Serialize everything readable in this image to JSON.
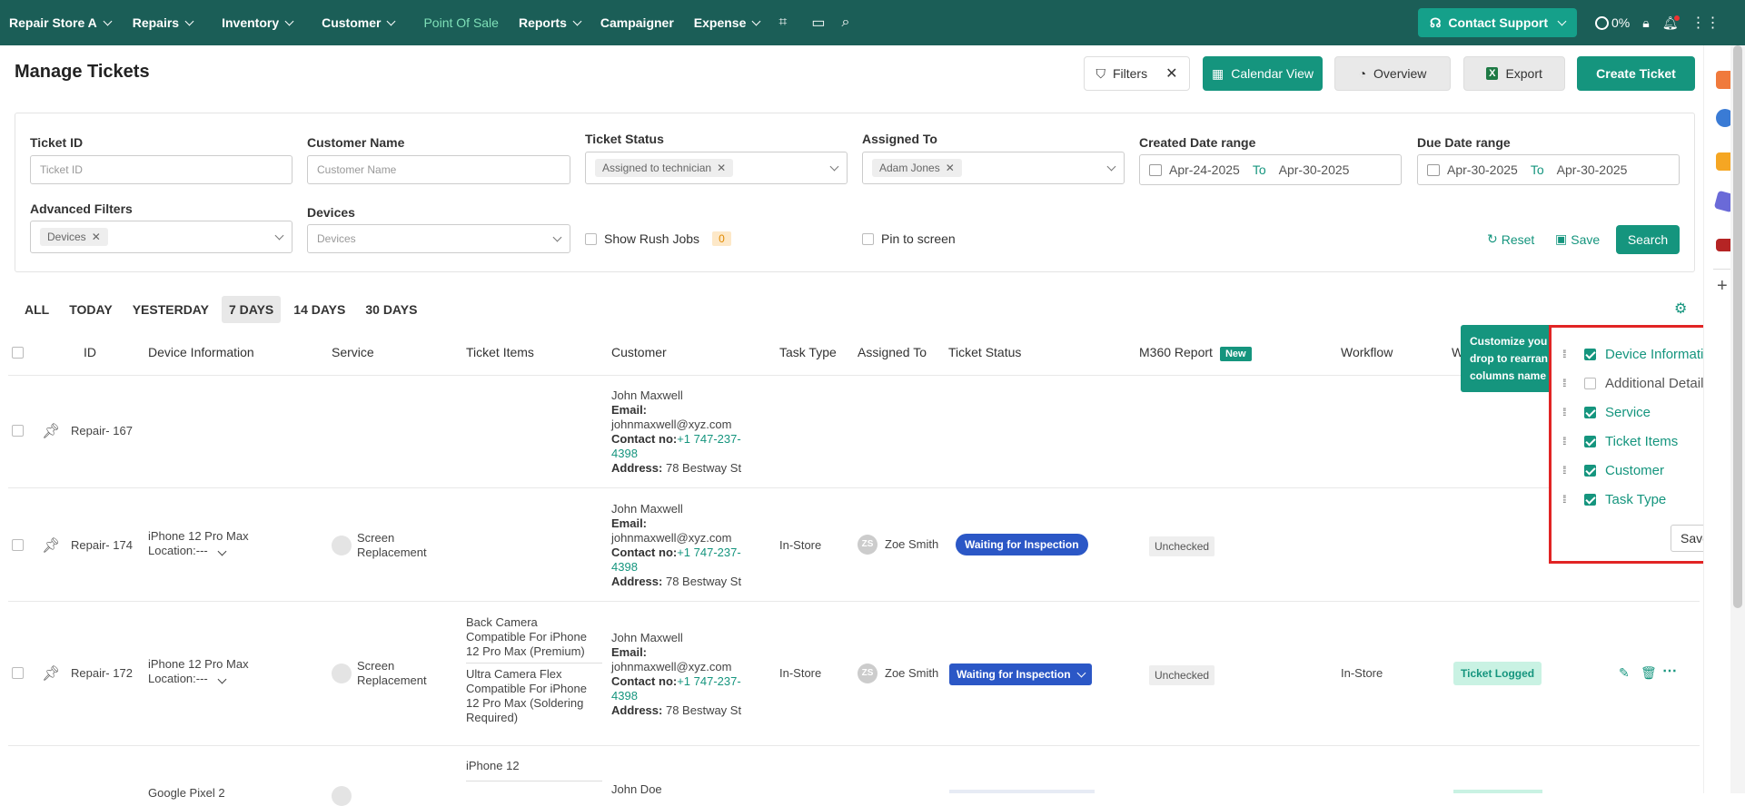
{
  "nav": {
    "store": "Repair Store A",
    "items": [
      "Repairs",
      "Inventory",
      "Customer",
      "Point Of Sale",
      "Reports",
      "Campaigner",
      "Expense"
    ],
    "support": "Contact Support",
    "usage": "0%"
  },
  "header": {
    "title": "Manage Tickets",
    "filters": "Filters",
    "calendar": "Calendar View",
    "overview": "Overview",
    "export": "Export",
    "create": "Create Ticket"
  },
  "filters": {
    "ticket_id": {
      "label": "Ticket ID",
      "placeholder": "Ticket ID"
    },
    "customer_name": {
      "label": "Customer Name",
      "placeholder": "Customer Name"
    },
    "ticket_status": {
      "label": "Ticket Status",
      "value": "Assigned to technician"
    },
    "assigned_to": {
      "label": "Assigned To",
      "value": "Adam Jones"
    },
    "created_range": {
      "label": "Created Date range",
      "from": "Apr-24-2025",
      "to_word": "To",
      "to": "Apr-30-2025"
    },
    "due_range": {
      "label": "Due Date range",
      "from": "Apr-30-2025",
      "to_word": "To",
      "to": "Apr-30-2025"
    },
    "advanced": {
      "label": "Advanced Filters",
      "value": "Devices"
    },
    "devices": {
      "label": "Devices",
      "placeholder": "Devices"
    },
    "rush": {
      "label": "Show Rush Jobs",
      "count": "0"
    },
    "pin": {
      "label": "Pin to screen"
    },
    "reset": "Reset",
    "save": "Save",
    "search": "Search"
  },
  "ranges": [
    "ALL",
    "TODAY",
    "YESTERDAY",
    "7 DAYS",
    "14 DAYS",
    "30 DAYS"
  ],
  "columns": {
    "id": "ID",
    "device": "Device Information",
    "service": "Service",
    "items": "Ticket Items",
    "customer": "Customer",
    "task": "Task Type",
    "assigned": "Assigned To",
    "status": "Ticket Status",
    "m360": "M360 Report",
    "new": "New",
    "workflow": "Workflow",
    "w": "W"
  },
  "rows": [
    {
      "id": "Repair- 167",
      "cust_name": "John Maxwell",
      "email_label": "Email:",
      "email": "johnmaxwell@xyz.com",
      "contact_label": "Contact no:",
      "phone1": "+1 747-237-",
      "phone2": "4398",
      "addr_label": "Address:",
      "addr": "78 Bestway St"
    },
    {
      "id": "Repair- 174",
      "device": "iPhone 12 Pro Max",
      "location": "Location:---",
      "service1": "Screen",
      "service2": "Replacement",
      "cust_name": "John Maxwell",
      "email_label": "Email:",
      "email": "johnmaxwell@xyz.com",
      "contact_label": "Contact no:",
      "phone1": "+1 747-237-",
      "phone2": "4398",
      "addr_label": "Address:",
      "addr": "78 Bestway St",
      "task": "In-Store",
      "assignee_initials": "ZS",
      "assignee": "Zoe Smith",
      "status": "Waiting for Inspection",
      "m360": "Unchecked"
    },
    {
      "id": "Repair- 172",
      "device": "iPhone 12 Pro Max",
      "location": "Location:---",
      "service1": "Screen",
      "service2": "Replacement",
      "item1a": "Back Camera",
      "item1b": "Compatible For iPhone",
      "item1c": "12 Pro Max (Premium)",
      "item2a": "Ultra Camera Flex",
      "item2b": "Compatible For iPhone",
      "item2c": "12 Pro Max (Soldering",
      "item2d": "Required)",
      "cust_name": "John Maxwell",
      "email_label": "Email:",
      "email": "johnmaxwell@xyz.com",
      "contact_label": "Contact no:",
      "phone1": "+1 747-237-",
      "phone2": "4398",
      "addr_label": "Address:",
      "addr": "78 Bestway St",
      "task": "In-Store",
      "assignee_initials": "ZS",
      "assignee": "Zoe Smith",
      "status": "Waiting for Inspection",
      "m360": "Unchecked",
      "workflow": "In-Store",
      "flow_status": "Ticket Logged"
    },
    {
      "device": "Google Pixel 2",
      "item": "iPhone 12",
      "cust_name": "John Doe"
    }
  ],
  "tooltip": {
    "l1": "Customize you",
    "l2": "drop to rearran",
    "l3": "columns name"
  },
  "col_panel": {
    "items": [
      {
        "label": "Device Information",
        "on": true
      },
      {
        "label": "Additional Detail",
        "on": false
      },
      {
        "label": "Service",
        "on": true
      },
      {
        "label": "Ticket Items",
        "on": true
      },
      {
        "label": "Customer",
        "on": true
      },
      {
        "label": "Task Type",
        "on": true
      }
    ],
    "save": "Save"
  },
  "colors": {
    "primary": "#15957e",
    "topbar": "#1b5e57",
    "status_blue": "#2b57c6",
    "highlight": "#e12424"
  }
}
